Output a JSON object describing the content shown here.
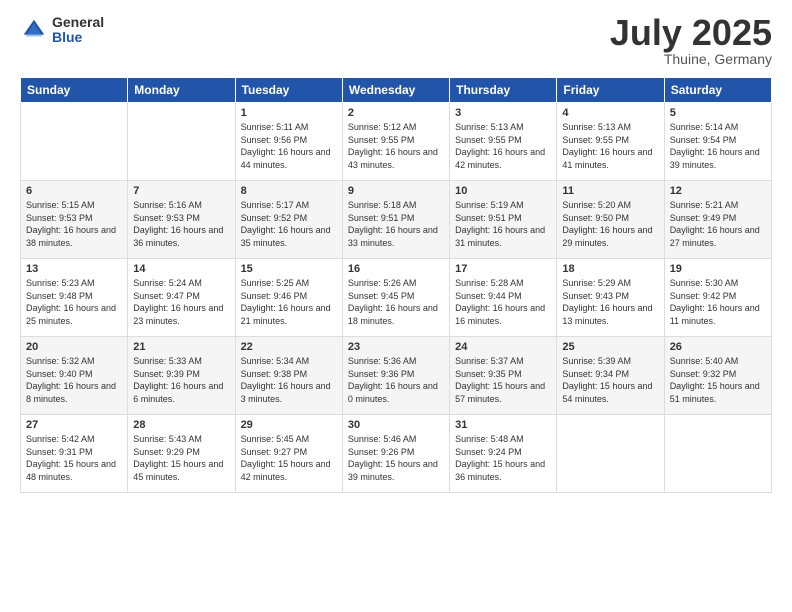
{
  "logo": {
    "general": "General",
    "blue": "Blue"
  },
  "title": "July 2025",
  "location": "Thuine, Germany",
  "header_days": [
    "Sunday",
    "Monday",
    "Tuesday",
    "Wednesday",
    "Thursday",
    "Friday",
    "Saturday"
  ],
  "weeks": [
    [
      {
        "day": "",
        "content": ""
      },
      {
        "day": "",
        "content": ""
      },
      {
        "day": "1",
        "sunrise": "Sunrise: 5:11 AM",
        "sunset": "Sunset: 9:56 PM",
        "daylight": "Daylight: 16 hours and 44 minutes."
      },
      {
        "day": "2",
        "sunrise": "Sunrise: 5:12 AM",
        "sunset": "Sunset: 9:55 PM",
        "daylight": "Daylight: 16 hours and 43 minutes."
      },
      {
        "day": "3",
        "sunrise": "Sunrise: 5:13 AM",
        "sunset": "Sunset: 9:55 PM",
        "daylight": "Daylight: 16 hours and 42 minutes."
      },
      {
        "day": "4",
        "sunrise": "Sunrise: 5:13 AM",
        "sunset": "Sunset: 9:55 PM",
        "daylight": "Daylight: 16 hours and 41 minutes."
      },
      {
        "day": "5",
        "sunrise": "Sunrise: 5:14 AM",
        "sunset": "Sunset: 9:54 PM",
        "daylight": "Daylight: 16 hours and 39 minutes."
      }
    ],
    [
      {
        "day": "6",
        "sunrise": "Sunrise: 5:15 AM",
        "sunset": "Sunset: 9:53 PM",
        "daylight": "Daylight: 16 hours and 38 minutes."
      },
      {
        "day": "7",
        "sunrise": "Sunrise: 5:16 AM",
        "sunset": "Sunset: 9:53 PM",
        "daylight": "Daylight: 16 hours and 36 minutes."
      },
      {
        "day": "8",
        "sunrise": "Sunrise: 5:17 AM",
        "sunset": "Sunset: 9:52 PM",
        "daylight": "Daylight: 16 hours and 35 minutes."
      },
      {
        "day": "9",
        "sunrise": "Sunrise: 5:18 AM",
        "sunset": "Sunset: 9:51 PM",
        "daylight": "Daylight: 16 hours and 33 minutes."
      },
      {
        "day": "10",
        "sunrise": "Sunrise: 5:19 AM",
        "sunset": "Sunset: 9:51 PM",
        "daylight": "Daylight: 16 hours and 31 minutes."
      },
      {
        "day": "11",
        "sunrise": "Sunrise: 5:20 AM",
        "sunset": "Sunset: 9:50 PM",
        "daylight": "Daylight: 16 hours and 29 minutes."
      },
      {
        "day": "12",
        "sunrise": "Sunrise: 5:21 AM",
        "sunset": "Sunset: 9:49 PM",
        "daylight": "Daylight: 16 hours and 27 minutes."
      }
    ],
    [
      {
        "day": "13",
        "sunrise": "Sunrise: 5:23 AM",
        "sunset": "Sunset: 9:48 PM",
        "daylight": "Daylight: 16 hours and 25 minutes."
      },
      {
        "day": "14",
        "sunrise": "Sunrise: 5:24 AM",
        "sunset": "Sunset: 9:47 PM",
        "daylight": "Daylight: 16 hours and 23 minutes."
      },
      {
        "day": "15",
        "sunrise": "Sunrise: 5:25 AM",
        "sunset": "Sunset: 9:46 PM",
        "daylight": "Daylight: 16 hours and 21 minutes."
      },
      {
        "day": "16",
        "sunrise": "Sunrise: 5:26 AM",
        "sunset": "Sunset: 9:45 PM",
        "daylight": "Daylight: 16 hours and 18 minutes."
      },
      {
        "day": "17",
        "sunrise": "Sunrise: 5:28 AM",
        "sunset": "Sunset: 9:44 PM",
        "daylight": "Daylight: 16 hours and 16 minutes."
      },
      {
        "day": "18",
        "sunrise": "Sunrise: 5:29 AM",
        "sunset": "Sunset: 9:43 PM",
        "daylight": "Daylight: 16 hours and 13 minutes."
      },
      {
        "day": "19",
        "sunrise": "Sunrise: 5:30 AM",
        "sunset": "Sunset: 9:42 PM",
        "daylight": "Daylight: 16 hours and 11 minutes."
      }
    ],
    [
      {
        "day": "20",
        "sunrise": "Sunrise: 5:32 AM",
        "sunset": "Sunset: 9:40 PM",
        "daylight": "Daylight: 16 hours and 8 minutes."
      },
      {
        "day": "21",
        "sunrise": "Sunrise: 5:33 AM",
        "sunset": "Sunset: 9:39 PM",
        "daylight": "Daylight: 16 hours and 6 minutes."
      },
      {
        "day": "22",
        "sunrise": "Sunrise: 5:34 AM",
        "sunset": "Sunset: 9:38 PM",
        "daylight": "Daylight: 16 hours and 3 minutes."
      },
      {
        "day": "23",
        "sunrise": "Sunrise: 5:36 AM",
        "sunset": "Sunset: 9:36 PM",
        "daylight": "Daylight: 16 hours and 0 minutes."
      },
      {
        "day": "24",
        "sunrise": "Sunrise: 5:37 AM",
        "sunset": "Sunset: 9:35 PM",
        "daylight": "Daylight: 15 hours and 57 minutes."
      },
      {
        "day": "25",
        "sunrise": "Sunrise: 5:39 AM",
        "sunset": "Sunset: 9:34 PM",
        "daylight": "Daylight: 15 hours and 54 minutes."
      },
      {
        "day": "26",
        "sunrise": "Sunrise: 5:40 AM",
        "sunset": "Sunset: 9:32 PM",
        "daylight": "Daylight: 15 hours and 51 minutes."
      }
    ],
    [
      {
        "day": "27",
        "sunrise": "Sunrise: 5:42 AM",
        "sunset": "Sunset: 9:31 PM",
        "daylight": "Daylight: 15 hours and 48 minutes."
      },
      {
        "day": "28",
        "sunrise": "Sunrise: 5:43 AM",
        "sunset": "Sunset: 9:29 PM",
        "daylight": "Daylight: 15 hours and 45 minutes."
      },
      {
        "day": "29",
        "sunrise": "Sunrise: 5:45 AM",
        "sunset": "Sunset: 9:27 PM",
        "daylight": "Daylight: 15 hours and 42 minutes."
      },
      {
        "day": "30",
        "sunrise": "Sunrise: 5:46 AM",
        "sunset": "Sunset: 9:26 PM",
        "daylight": "Daylight: 15 hours and 39 minutes."
      },
      {
        "day": "31",
        "sunrise": "Sunrise: 5:48 AM",
        "sunset": "Sunset: 9:24 PM",
        "daylight": "Daylight: 15 hours and 36 minutes."
      },
      {
        "day": "",
        "content": ""
      },
      {
        "day": "",
        "content": ""
      }
    ]
  ]
}
